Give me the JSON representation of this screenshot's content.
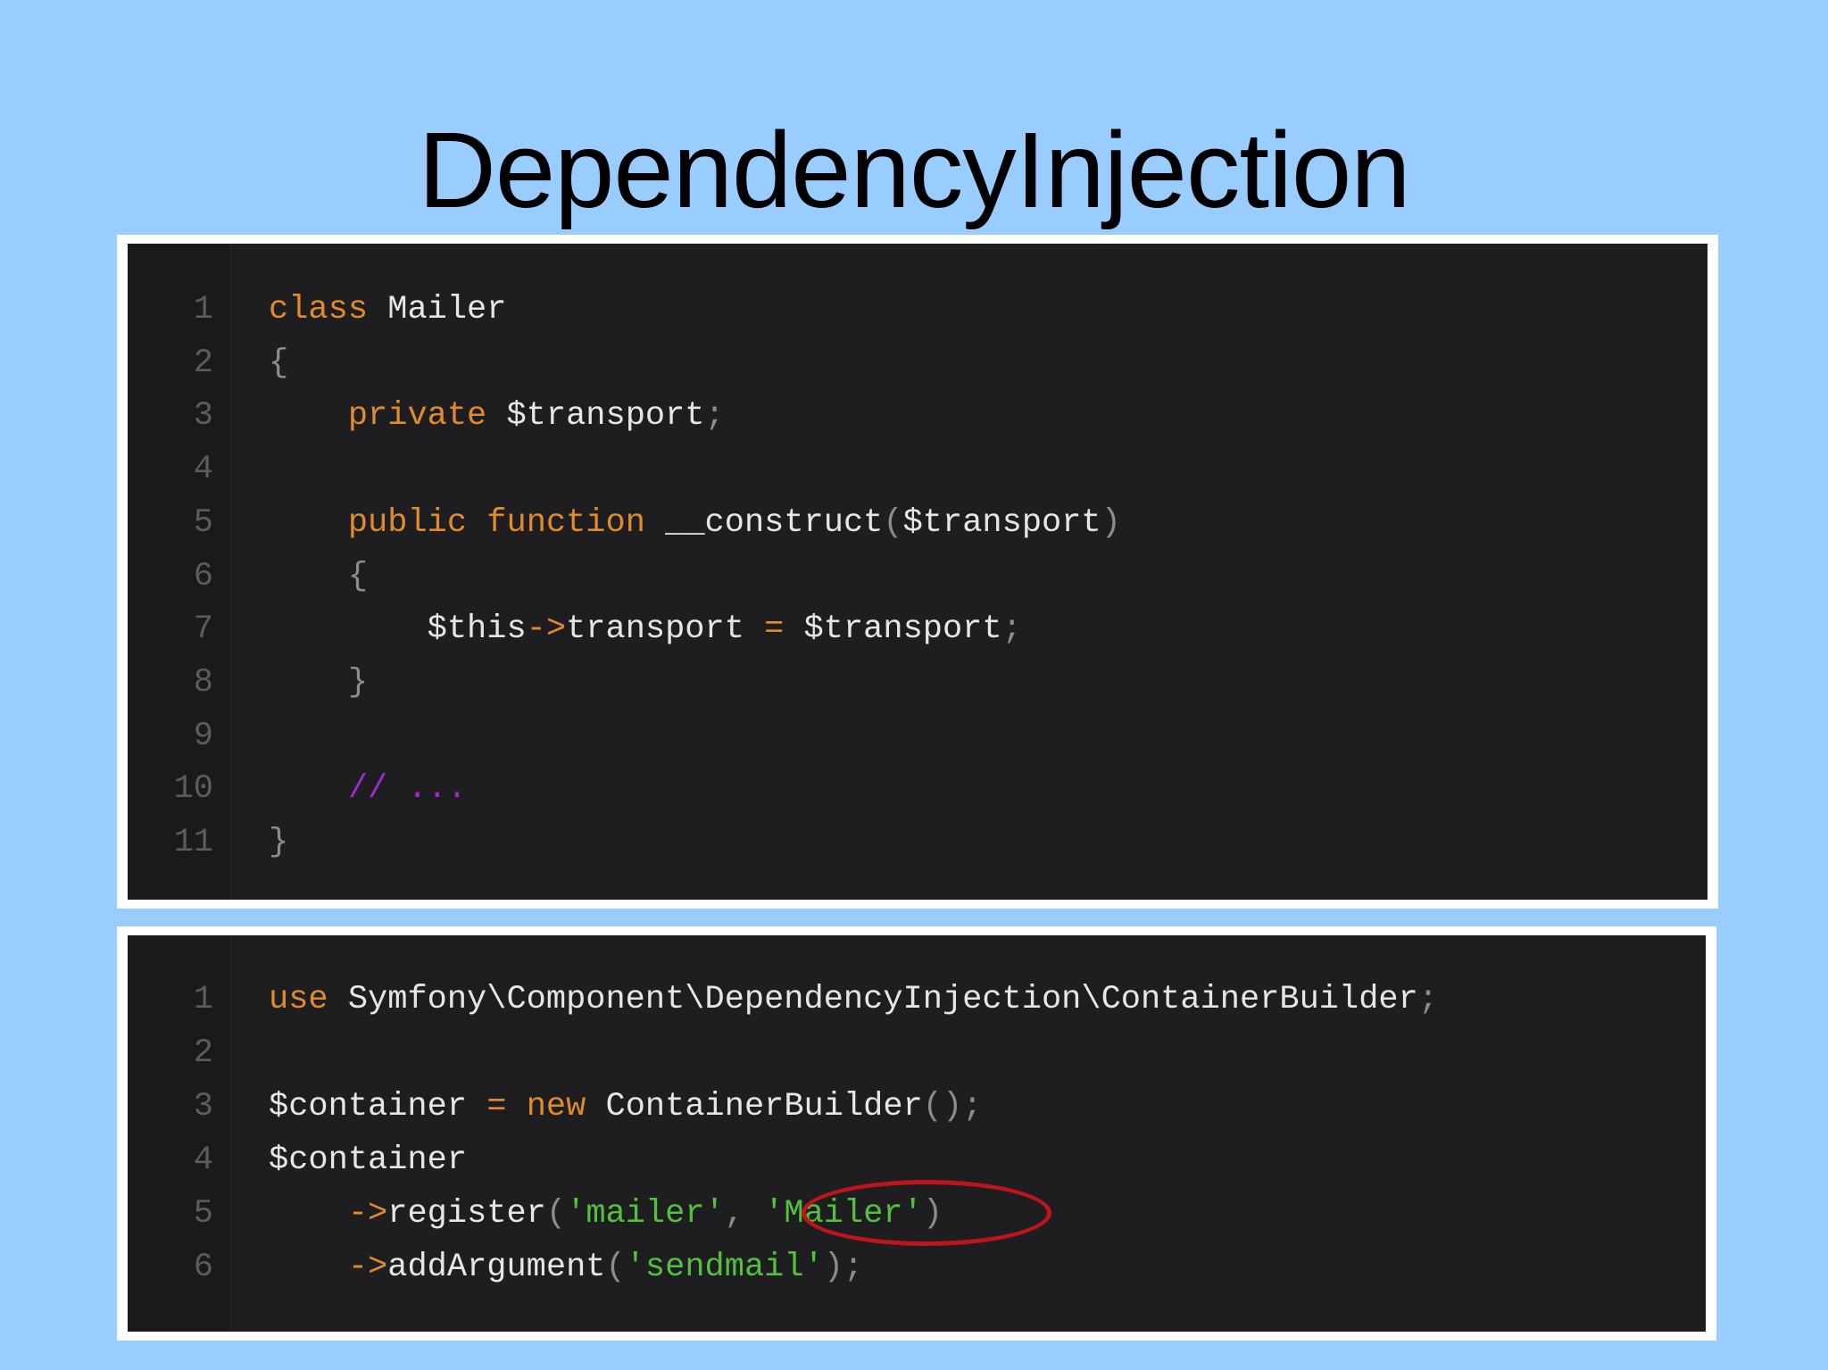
{
  "slide": {
    "title": "DependencyInjection"
  },
  "top_code": {
    "lines": [
      {
        "num": "1",
        "parts": [
          {
            "t": "class",
            "c": "kw"
          },
          {
            "t": " Mailer",
            "c": "txt"
          }
        ]
      },
      {
        "num": "2",
        "parts": [
          {
            "t": "{",
            "c": "punct"
          }
        ]
      },
      {
        "num": "3",
        "parts": [
          {
            "t": "    ",
            "c": "txt"
          },
          {
            "t": "private",
            "c": "kw"
          },
          {
            "t": " $transport",
            "c": "txt"
          },
          {
            "t": ";",
            "c": "punct"
          }
        ]
      },
      {
        "num": "4",
        "parts": []
      },
      {
        "num": "5",
        "parts": [
          {
            "t": "    ",
            "c": "txt"
          },
          {
            "t": "public",
            "c": "kw"
          },
          {
            "t": " ",
            "c": "txt"
          },
          {
            "t": "function",
            "c": "kw"
          },
          {
            "t": " __construct",
            "c": "txt"
          },
          {
            "t": "(",
            "c": "punct"
          },
          {
            "t": "$transport",
            "c": "txt"
          },
          {
            "t": ")",
            "c": "punct"
          }
        ]
      },
      {
        "num": "6",
        "parts": [
          {
            "t": "    ",
            "c": "txt"
          },
          {
            "t": "{",
            "c": "punct"
          }
        ]
      },
      {
        "num": "7",
        "parts": [
          {
            "t": "        $this",
            "c": "txt"
          },
          {
            "t": "->",
            "c": "op"
          },
          {
            "t": "transport ",
            "c": "txt"
          },
          {
            "t": "=",
            "c": "op"
          },
          {
            "t": " $transport",
            "c": "txt"
          },
          {
            "t": ";",
            "c": "punct"
          }
        ]
      },
      {
        "num": "8",
        "parts": [
          {
            "t": "    ",
            "c": "txt"
          },
          {
            "t": "}",
            "c": "punct"
          }
        ]
      },
      {
        "num": "9",
        "parts": []
      },
      {
        "num": "10",
        "parts": [
          {
            "t": "    ",
            "c": "txt"
          },
          {
            "t": "// ...",
            "c": "cmt"
          }
        ]
      },
      {
        "num": "11",
        "parts": [
          {
            "t": "}",
            "c": "punct"
          }
        ]
      }
    ]
  },
  "bottom_code": {
    "lines": [
      {
        "num": "1",
        "parts": [
          {
            "t": "use",
            "c": "kw"
          },
          {
            "t": " Symfony\\Component\\DependencyInjection\\ContainerBuilder",
            "c": "txt"
          },
          {
            "t": ";",
            "c": "punct"
          }
        ]
      },
      {
        "num": "2",
        "parts": []
      },
      {
        "num": "3",
        "parts": [
          {
            "t": "$container ",
            "c": "txt"
          },
          {
            "t": "=",
            "c": "op"
          },
          {
            "t": " ",
            "c": "txt"
          },
          {
            "t": "new",
            "c": "kw"
          },
          {
            "t": " ContainerBuilder",
            "c": "txt"
          },
          {
            "t": "();",
            "c": "punct"
          }
        ]
      },
      {
        "num": "4",
        "parts": [
          {
            "t": "$container",
            "c": "txt"
          }
        ]
      },
      {
        "num": "5",
        "parts": [
          {
            "t": "    ",
            "c": "txt"
          },
          {
            "t": "->",
            "c": "op"
          },
          {
            "t": "register",
            "c": "txt"
          },
          {
            "t": "(",
            "c": "punct"
          },
          {
            "t": "'mailer'",
            "c": "str"
          },
          {
            "t": ", ",
            "c": "punct"
          },
          {
            "t": "'Mailer'",
            "c": "str"
          },
          {
            "t": ")",
            "c": "punct"
          }
        ]
      },
      {
        "num": "6",
        "parts": [
          {
            "t": "    ",
            "c": "txt"
          },
          {
            "t": "->",
            "c": "op"
          },
          {
            "t": "addArgument",
            "c": "txt"
          },
          {
            "t": "(",
            "c": "punct"
          },
          {
            "t": "'sendmail'",
            "c": "str"
          },
          {
            "t": ");",
            "c": "punct"
          }
        ]
      }
    ]
  },
  "colors": {
    "background": "#99ccff",
    "code_background": "#1e1e20",
    "keyword": "#e08a2c",
    "string": "#55c03d",
    "comment": "#a02ad0",
    "highlight_ring": "#c0141c"
  }
}
